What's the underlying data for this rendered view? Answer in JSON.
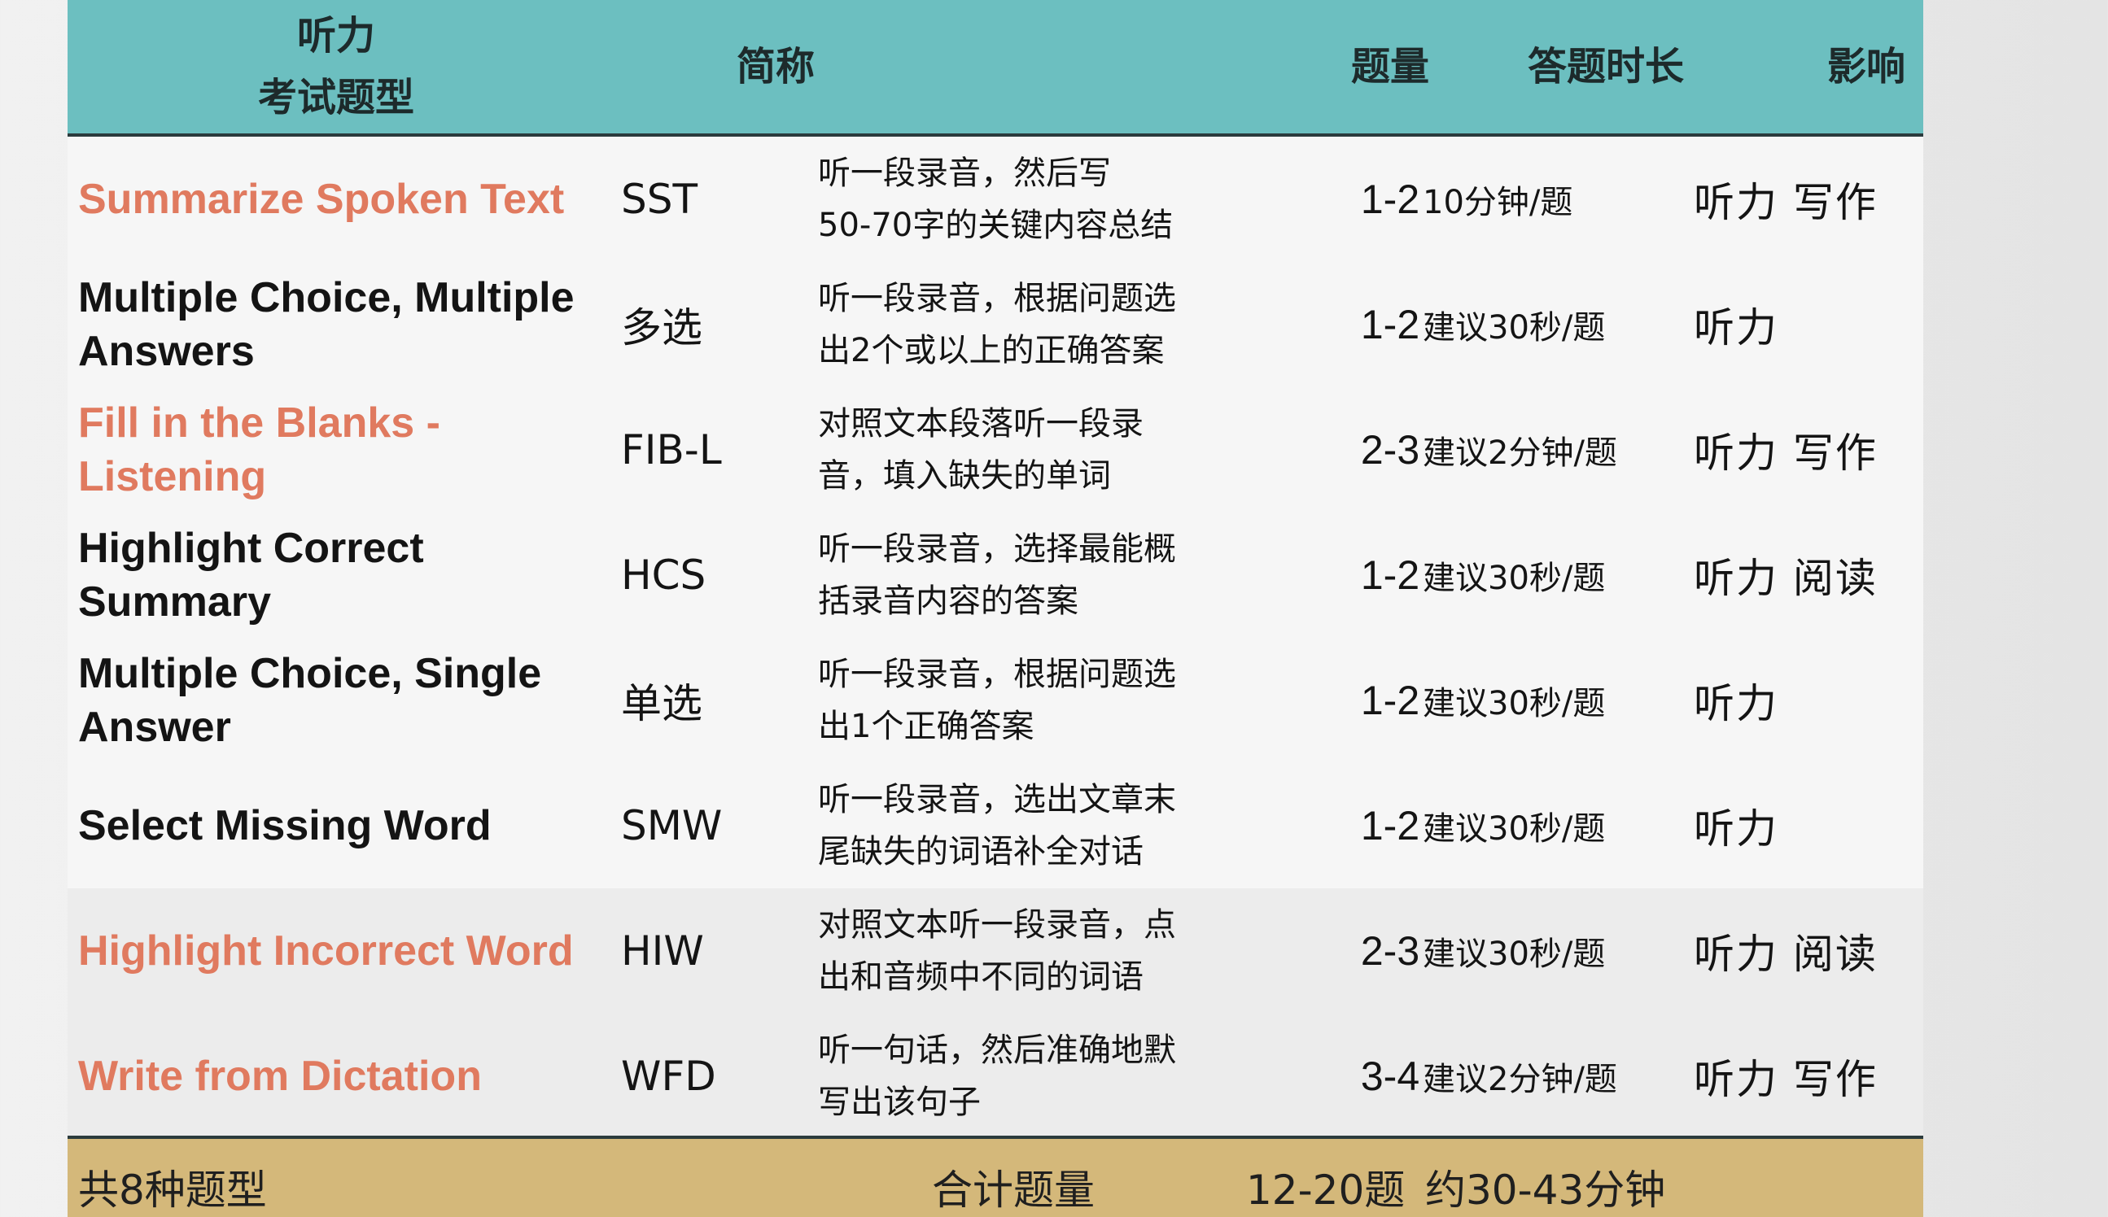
{
  "header": {
    "type_line1": "听力",
    "type_line2": "考试题型",
    "abbr": "简称",
    "count": "题量",
    "time": "答题时长",
    "impact": "影响"
  },
  "rows": [
    {
      "type": "Summarize Spoken Text",
      "highlight": true,
      "abbr": "SST",
      "desc1": "听一段录音，然后写",
      "desc2": "50-70字的关键内容总结",
      "count": "1-2",
      "time": "10分钟/题",
      "impact": "听力 写作"
    },
    {
      "type": "Multiple Choice, Multiple Answers",
      "highlight": false,
      "abbr": "多选",
      "desc1": "听一段录音，根据问题选",
      "desc2": "出2个或以上的正确答案",
      "count": "1-2",
      "time": "建议30秒/题",
      "impact": "听力"
    },
    {
      "type": "Fill in the Blanks - Listening",
      "highlight": true,
      "abbr": "FIB-L",
      "desc1": "对照文本段落听一段录",
      "desc2": "音，填入缺失的单词",
      "count": "2-3",
      "time": "建议2分钟/题",
      "impact": "听力 写作"
    },
    {
      "type": "Highlight Correct Summary",
      "highlight": false,
      "abbr": "HCS",
      "desc1": "听一段录音，选择最能概",
      "desc2": "括录音内容的答案",
      "count": "1-2",
      "time": "建议30秒/题",
      "impact": "听力 阅读"
    },
    {
      "type": "Multiple Choice, Single Answer",
      "highlight": false,
      "abbr": "单选",
      "desc1": "听一段录音，根据问题选",
      "desc2": "出1个正确答案",
      "count": "1-2",
      "time": "建议30秒/题",
      "impact": "听力"
    },
    {
      "type": "Select Missing Word",
      "highlight": false,
      "abbr": "SMW",
      "desc1": "听一段录音，选出文章末",
      "desc2": "尾缺失的词语补全对话",
      "count": "1-2",
      "time": "建议30秒/题",
      "impact": "听力"
    },
    {
      "type": "Highlight Incorrect Word",
      "highlight": true,
      "abbr": "HIW",
      "desc1": "对照文本听一段录音，点",
      "desc2": "出和音频中不同的词语",
      "count": "2-3",
      "time": "建议30秒/题",
      "impact": "听力 阅读"
    },
    {
      "type": "Write from Dictation",
      "highlight": true,
      "abbr": "WFD",
      "desc1": "听一句话，然后准确地默",
      "desc2": "写出该句子",
      "count": "3-4",
      "time": "建议2分钟/题",
      "impact": "听力 写作"
    }
  ],
  "footer": {
    "types_total": "共8种题型",
    "total_label": "合计题量",
    "total_count": "12-20题",
    "total_time": "约30-43分钟"
  },
  "colors": {
    "header_bg": "#6cbfc0",
    "highlight_text": "#e07a5f",
    "footer_bg": "#d4b87a",
    "row_divider": "#7cc4c6"
  }
}
